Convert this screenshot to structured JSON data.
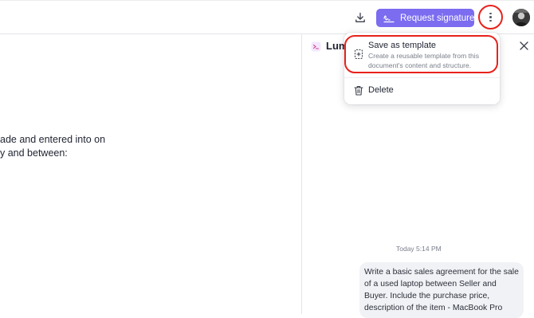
{
  "toolbar": {
    "request_signatures_label": "Request signatures",
    "download_icon": "download-icon",
    "more_icon": "more-vertical-icon",
    "accent_color": "#7b6cf0",
    "highlight_color": "#e8221c"
  },
  "document": {
    "line1": "ade and entered into on",
    "line2": "y and between:"
  },
  "panel": {
    "title": "Lum",
    "close_icon": "close-icon"
  },
  "menu": {
    "save_template": {
      "title": "Save as template",
      "description": "Create a reusable template from this document's content and structure."
    },
    "delete": {
      "label": "Delete"
    }
  },
  "chat": {
    "timestamp": "Today 5:14 PM",
    "message": "Write a basic sales agreement for the sale of a used laptop between Seller and Buyer. Include the purchase price, description of the item - MacBook Pro"
  }
}
